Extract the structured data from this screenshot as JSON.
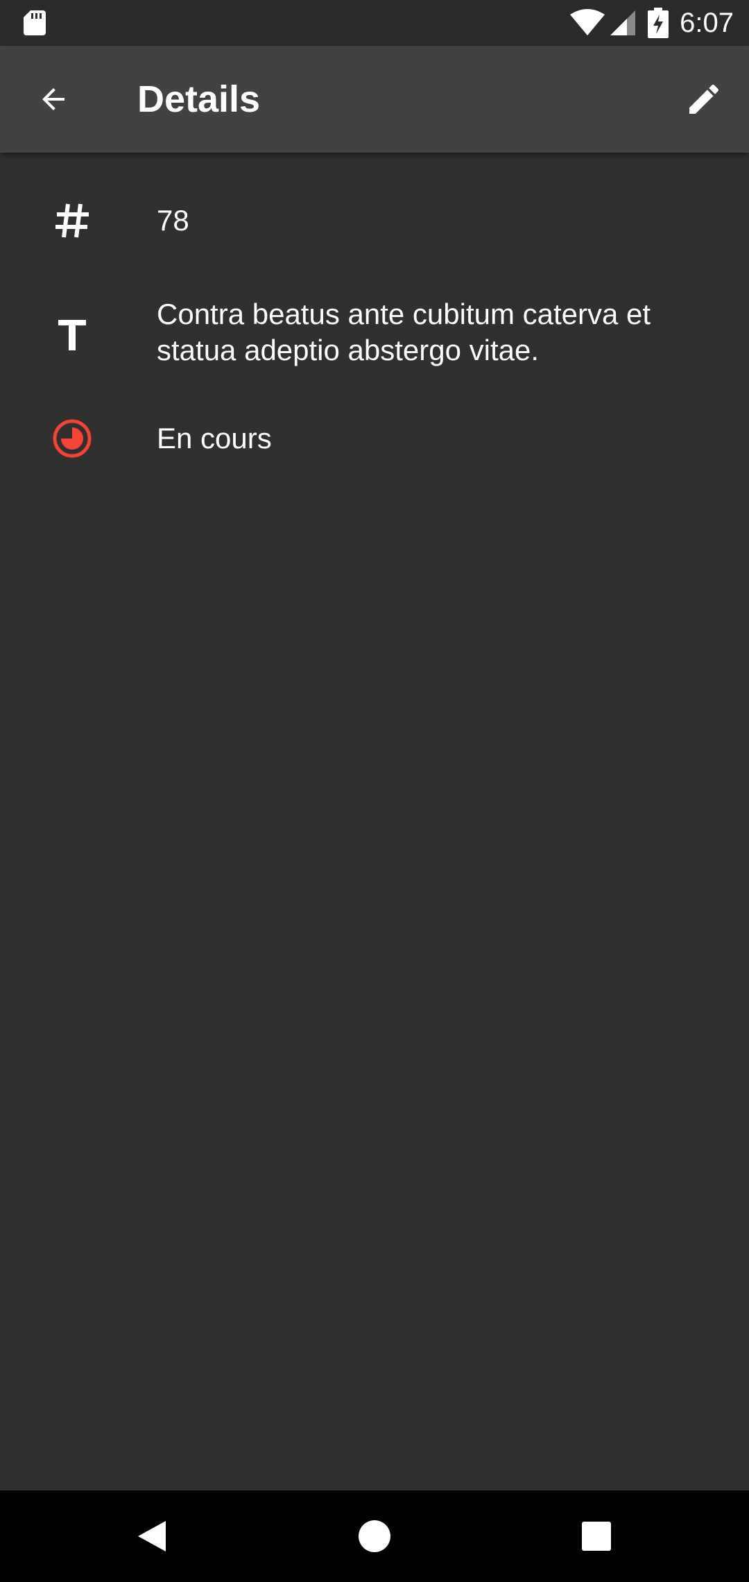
{
  "status_bar": {
    "time": "6:07",
    "icons": [
      "sd-card-icon",
      "wifi-icon",
      "cell-signal-icon",
      "battery-charging-icon"
    ]
  },
  "app_bar": {
    "title": "Details",
    "back_icon": "arrow-back-icon",
    "edit_icon": "pencil-icon"
  },
  "details": {
    "number": "78",
    "text": "Contra beatus ante cubitum caterva et statua adeptio abstergo vitae.",
    "status": "En cours"
  },
  "colors": {
    "background": "#303030",
    "app_bar": "#424242",
    "status_bar": "#2b2b2b",
    "status_accent": "#f44336"
  },
  "nav_bar": {
    "icons": [
      "nav-back-icon",
      "nav-home-icon",
      "nav-recents-icon"
    ]
  }
}
